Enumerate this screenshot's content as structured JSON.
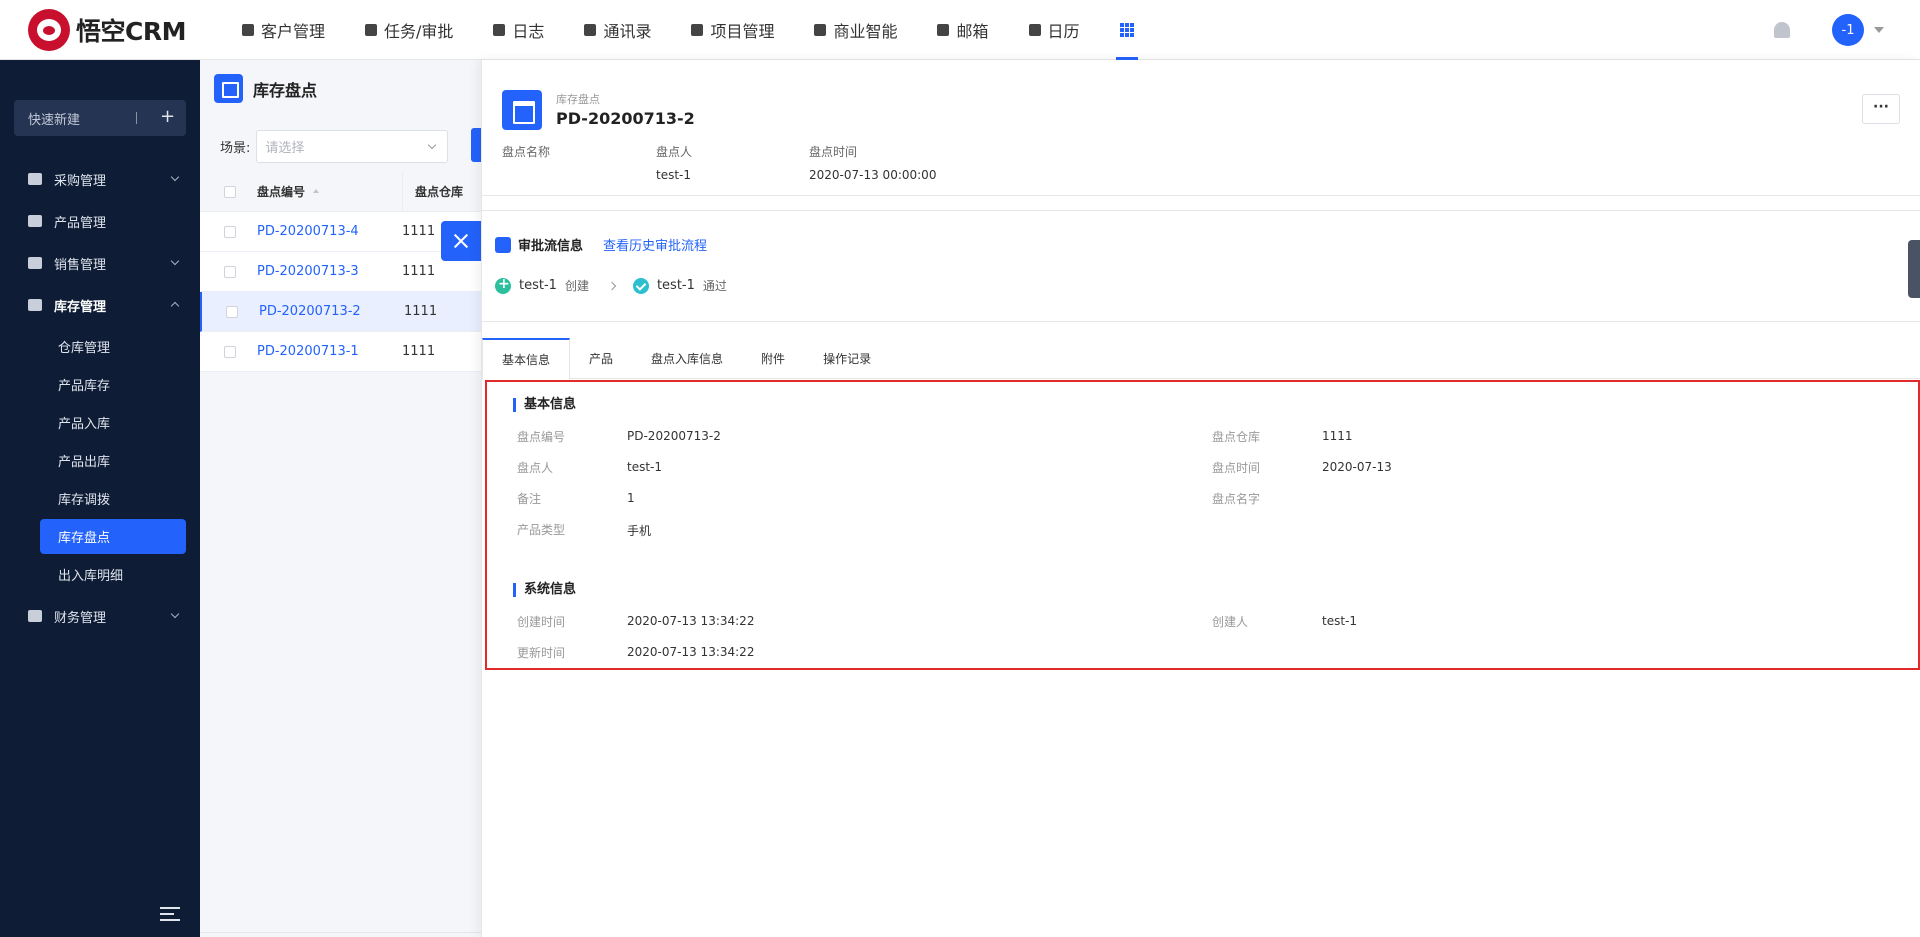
{
  "brand": {
    "name": "悟空CRM"
  },
  "nav": [
    {
      "label": "客户管理"
    },
    {
      "label": "任务/审批"
    },
    {
      "label": "日志"
    },
    {
      "label": "通讯录"
    },
    {
      "label": "项目管理"
    },
    {
      "label": "商业智能"
    },
    {
      "label": "邮箱"
    },
    {
      "label": "日历"
    }
  ],
  "user": {
    "avatar_text": "-1"
  },
  "sidebar": {
    "quick_new": "快速新建",
    "menu": [
      {
        "label": "采购管理"
      },
      {
        "label": "产品管理"
      },
      {
        "label": "销售管理"
      },
      {
        "label": "库存管理"
      },
      {
        "label": "财务管理"
      }
    ],
    "submenu": [
      {
        "label": "仓库管理"
      },
      {
        "label": "产品库存"
      },
      {
        "label": "产品入库"
      },
      {
        "label": "产品出库"
      },
      {
        "label": "库存调拨"
      },
      {
        "label": "库存盘点"
      },
      {
        "label": "出入库明细"
      }
    ]
  },
  "list": {
    "title": "库存盘点",
    "scene_label": "场景:",
    "scene_placeholder": "请选择",
    "columns": [
      "盘点编号",
      "盘点仓库"
    ],
    "rows": [
      {
        "code": "PD-20200713-4",
        "warehouse": "1111"
      },
      {
        "code": "PD-20200713-3",
        "warehouse": "1111"
      },
      {
        "code": "PD-20200713-2",
        "warehouse": "1111"
      },
      {
        "code": "PD-20200713-1",
        "warehouse": "1111"
      }
    ]
  },
  "detail": {
    "subtitle": "库存盘点",
    "title": "PD-20200713-2",
    "more": "···",
    "summary": [
      {
        "label": "盘点名称",
        "value": ""
      },
      {
        "label": "盘点人",
        "value": "test-1"
      },
      {
        "label": "盘点时间",
        "value": "2020-07-13 00:00:00"
      }
    ],
    "flow": {
      "title": "审批流信息",
      "history_link": "查看历史审批流程",
      "steps": [
        {
          "user": "test-1",
          "action": "创建"
        },
        {
          "user": "test-1",
          "action": "通过"
        }
      ]
    },
    "tabs": [
      "基本信息",
      "产品",
      "盘点入库信息",
      "附件",
      "操作记录"
    ],
    "basic": {
      "title": "基本信息",
      "fields": [
        {
          "label": "盘点编号",
          "value": "PD-20200713-2"
        },
        {
          "label": "盘点仓库",
          "value": "1111"
        },
        {
          "label": "盘点人",
          "value": "test-1"
        },
        {
          "label": "盘点时间",
          "value": "2020-07-13"
        },
        {
          "label": "备注",
          "value": "1"
        },
        {
          "label": "盘点名字",
          "value": ""
        },
        {
          "label": "产品类型",
          "value": "手机"
        }
      ]
    },
    "system": {
      "title": "系统信息",
      "fields": [
        {
          "label": "创建时间",
          "value": "2020-07-13 13:34:22"
        },
        {
          "label": "创建人",
          "value": "test-1"
        },
        {
          "label": "更新时间",
          "value": "2020-07-13 13:34:22"
        }
      ]
    }
  }
}
